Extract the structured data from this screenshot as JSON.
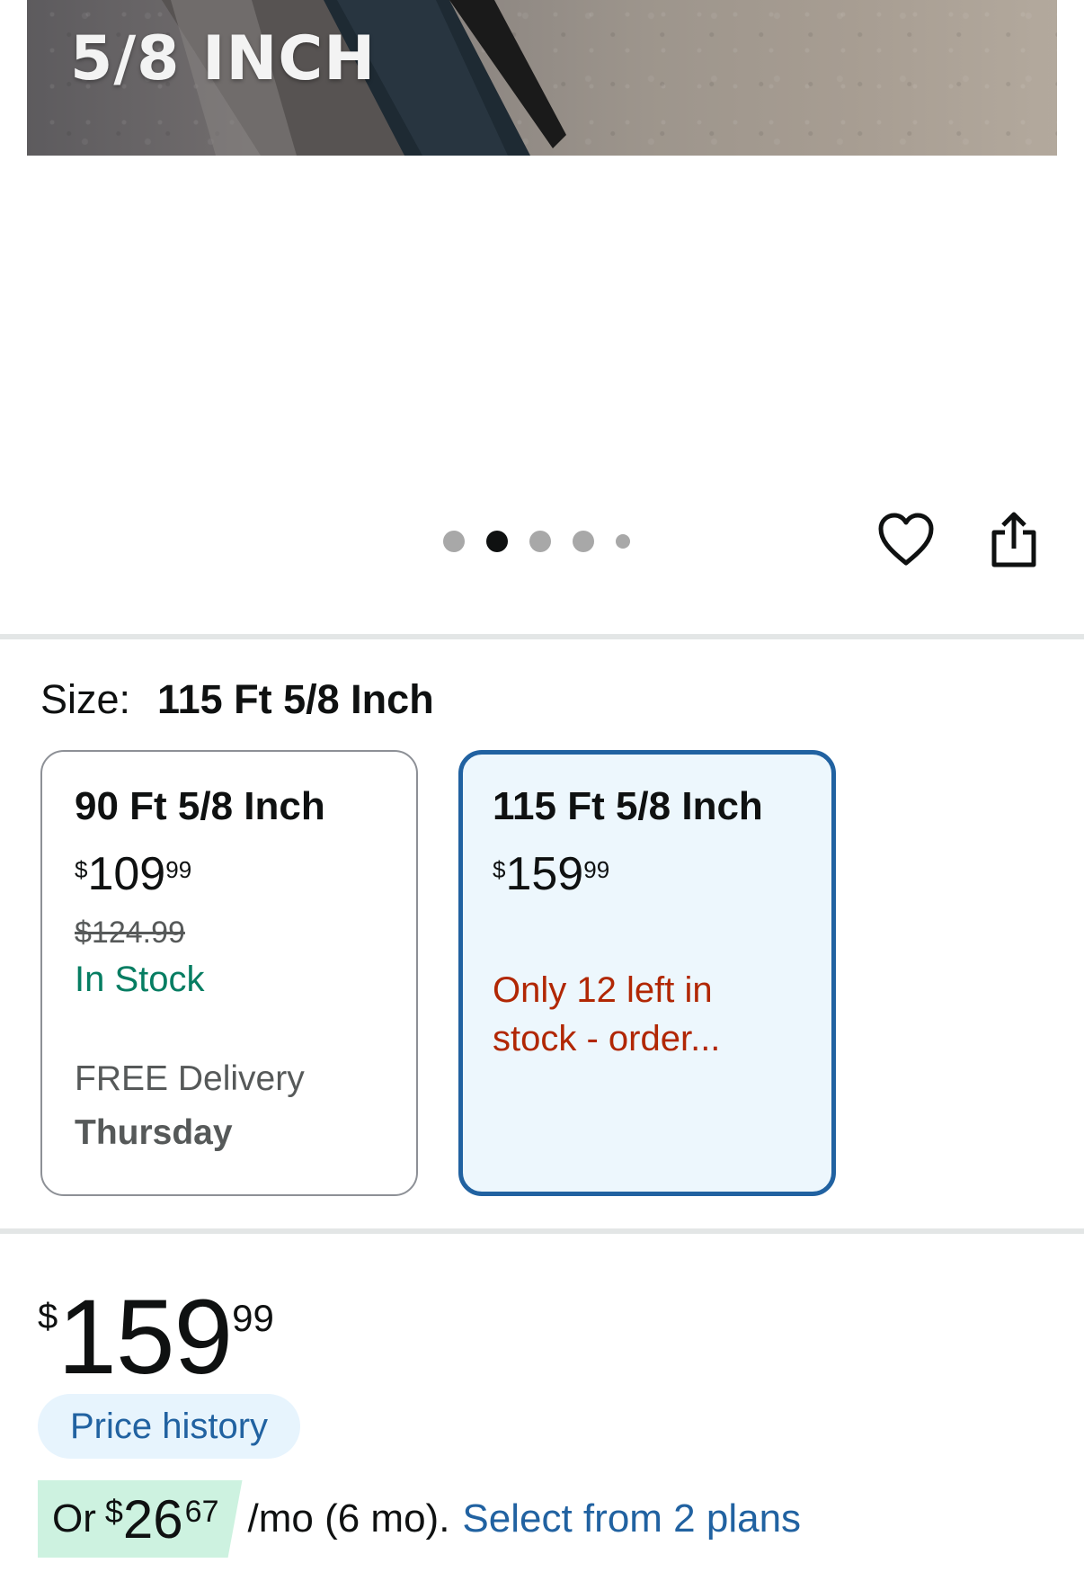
{
  "hero": {
    "overlay_text": "5/8 INCH"
  },
  "carousel": {
    "total_dots": 5,
    "active_index": 1
  },
  "actions": {
    "favorite_icon": "heart-icon",
    "share_icon": "share-icon"
  },
  "size": {
    "label": "Size:",
    "selected_value": "115 Ft 5/8 Inch"
  },
  "options": [
    {
      "title": "90 Ft 5/8 Inch",
      "price_symbol": "$",
      "price_whole": "109",
      "price_fraction": "99",
      "list_price": "$124.99",
      "availability": "In Stock",
      "delivery_label": "FREE Delivery",
      "delivery_day": "Thursday",
      "selected": false
    },
    {
      "title": "115 Ft 5/8 Inch",
      "price_symbol": "$",
      "price_whole": "159",
      "price_fraction": "99",
      "availability": "Only 12 left in stock - order...",
      "selected": true
    }
  ],
  "price": {
    "symbol": "$",
    "whole": "159",
    "fraction": "99"
  },
  "price_history_label": "Price history",
  "monthly": {
    "prefix": "Or",
    "symbol": "$",
    "whole": "26",
    "fraction": "67",
    "suffix": "/mo (6 mo).",
    "link_text": "Select from 2 plans"
  },
  "colors": {
    "link_blue": "#2162a1",
    "in_stock_green": "#067d62",
    "low_stock_red": "#b12704",
    "selected_border": "#2162a1",
    "selected_background": "#edf7fd",
    "monthly_highlight": "#cdf2e0"
  }
}
